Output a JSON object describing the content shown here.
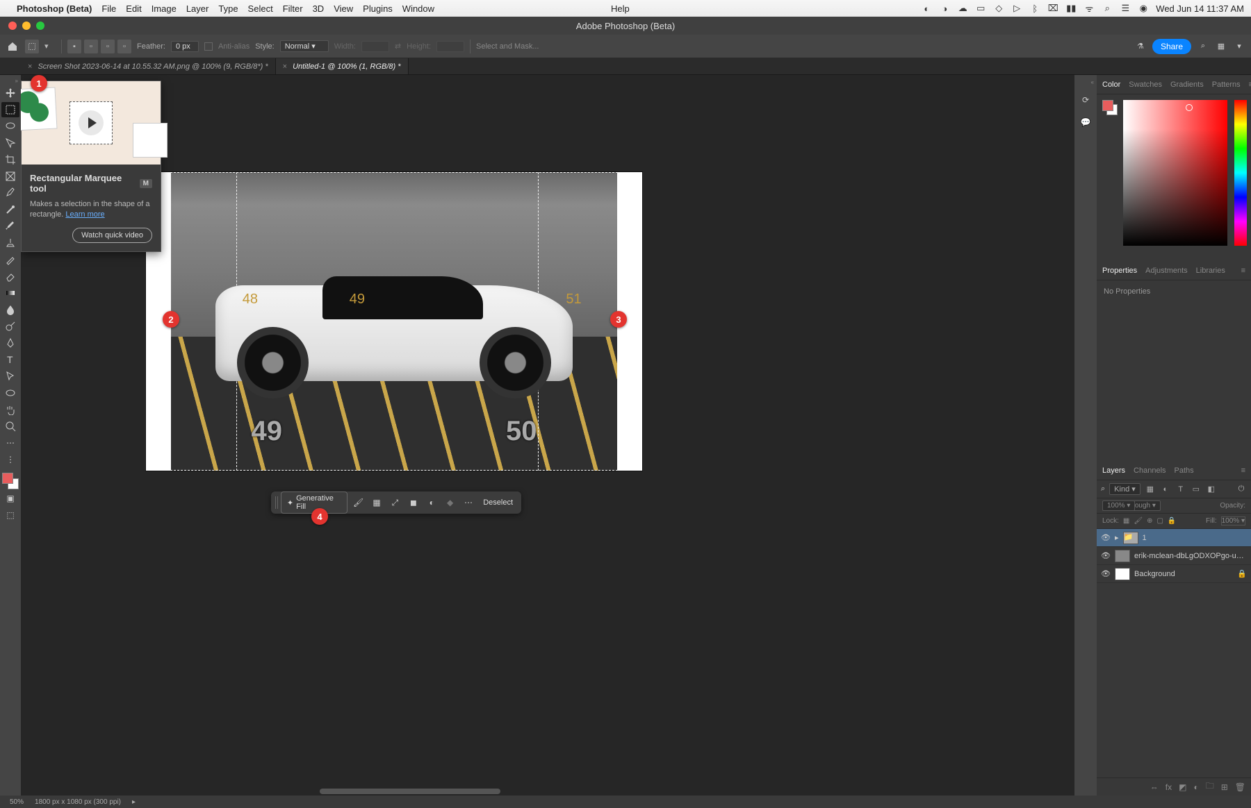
{
  "menubar": {
    "app": "Photoshop (Beta)",
    "items": [
      "File",
      "Edit",
      "Image",
      "Layer",
      "Type",
      "Select",
      "Filter",
      "3D",
      "View",
      "Plugins",
      "Window"
    ],
    "help": "Help",
    "datetime": "Wed Jun 14  11:37 AM"
  },
  "window": {
    "title": "Adobe Photoshop (Beta)"
  },
  "optionsbar": {
    "feather_label": "Feather:",
    "feather_value": "0 px",
    "antialias": "Anti-alias",
    "style_label": "Style:",
    "style_value": "Normal",
    "width_label": "Width:",
    "height_label": "Height:",
    "select_mask": "Select and Mask...",
    "share": "Share"
  },
  "tabs": [
    {
      "label": "Screen Shot 2023-06-14 at 10.55.32 AM.png @ 100% (9, RGB/8*) *",
      "active": false
    },
    {
      "label": "Untitled-1 @ 100% (1, RGB/8) *",
      "active": true
    }
  ],
  "tooltip": {
    "title": "Rectangular Marquee tool",
    "key": "M",
    "desc": "Makes a selection in the shape of a rectangle. ",
    "learn": "Learn more",
    "watch": "Watch quick video"
  },
  "contextbar": {
    "genfill": "Generative Fill",
    "deselect": "Deselect"
  },
  "rightpanels": {
    "color_tabs": [
      "Color",
      "Swatches",
      "Gradients",
      "Patterns"
    ],
    "props_tabs": [
      "Properties",
      "Adjustments",
      "Libraries"
    ],
    "no_props": "No Properties",
    "layers_tabs": [
      "Layers",
      "Channels",
      "Paths"
    ],
    "kind_label": "Kind",
    "blend_mode": "Pass Through",
    "opacity_label": "Opacity:",
    "opacity_value": "100%",
    "lock_label": "Lock:",
    "fill_label": "Fill:",
    "fill_value": "100%"
  },
  "layers": [
    {
      "name": "1",
      "type": "group",
      "selected": true
    },
    {
      "name": "erik-mclean-dbLgODXOPgo-unsplash",
      "type": "image",
      "selected": false
    },
    {
      "name": "Background",
      "type": "bg",
      "locked": true
    }
  ],
  "statusbar": {
    "zoom": "50%",
    "dims": "1800 px x 1080 px (300 ppi)"
  },
  "annotations": {
    "b1": "1",
    "b2": "2",
    "b3": "3",
    "b4": "4"
  },
  "canvas_numbers": {
    "p49": "49",
    "p50": "50",
    "w48": "48",
    "w49": "49",
    "w51": "51"
  }
}
